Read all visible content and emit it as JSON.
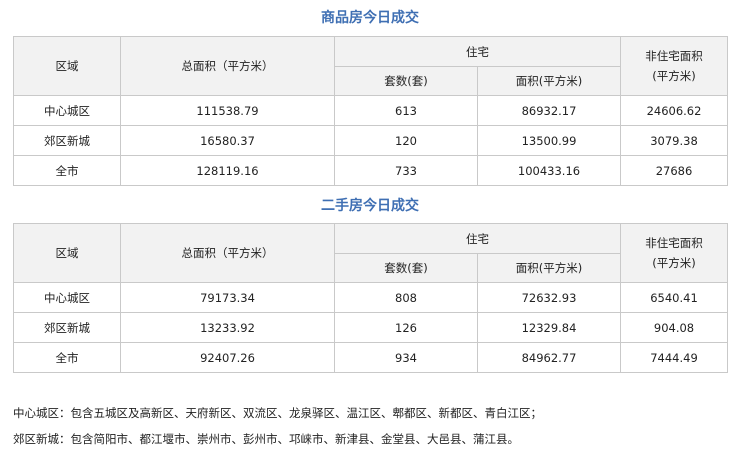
{
  "tables": [
    {
      "title": "商品房今日成交",
      "headers": {
        "region": "区域",
        "total_area": "总面积（平方米）",
        "residential": "住宅",
        "sets": "套数(套)",
        "area": "面积(平方米)",
        "non_residential_line1": "非住宅面积",
        "non_residential_line2": "(平方米)"
      },
      "rows": [
        {
          "region": "中心城区",
          "total": "111538.79",
          "sets": "613",
          "area": "86932.17",
          "non_res": "24606.62"
        },
        {
          "region": "郊区新城",
          "total": "16580.37",
          "sets": "120",
          "area": "13500.99",
          "non_res": "3079.38"
        },
        {
          "region": "全市",
          "total": "128119.16",
          "sets": "733",
          "area": "100433.16",
          "non_res": "27686"
        }
      ]
    },
    {
      "title": "二手房今日成交",
      "headers": {
        "region": "区域",
        "total_area": "总面积（平方米）",
        "residential": "住宅",
        "sets": "套数(套)",
        "area": "面积(平方米)",
        "non_residential_line1": "非住宅面积",
        "non_residential_line2": "(平方米)"
      },
      "rows": [
        {
          "region": "中心城区",
          "total": "79173.34",
          "sets": "808",
          "area": "72632.93",
          "non_res": "6540.41"
        },
        {
          "region": "郊区新城",
          "total": "13233.92",
          "sets": "126",
          "area": "12329.84",
          "non_res": "904.08"
        },
        {
          "region": "全市",
          "total": "92407.26",
          "sets": "934",
          "area": "84962.77",
          "non_res": "7444.49"
        }
      ]
    }
  ],
  "notes": [
    "中心城区：包含五城区及高新区、天府新区、双流区、龙泉驿区、温江区、郫都区、新都区、青白江区；",
    "郊区新城：包含简阳市、都江堰市、崇州市、彭州市、邛崃市、新津县、金堂县、大邑县、蒲江县。"
  ]
}
